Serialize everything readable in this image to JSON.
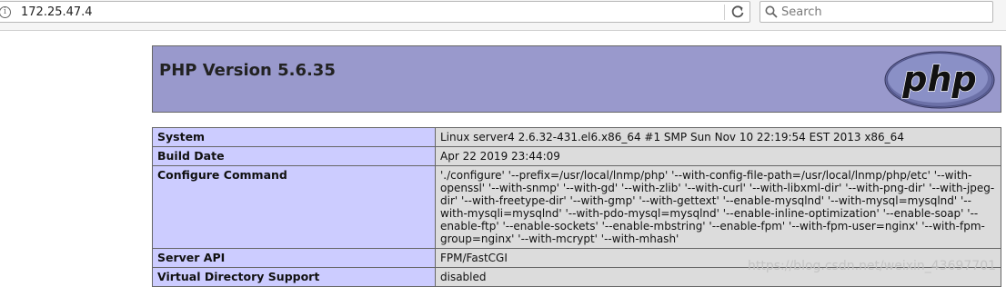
{
  "browser": {
    "url": "172.25.47.4",
    "search_placeholder": "Search"
  },
  "page": {
    "title": "PHP Version 5.6.35",
    "logo_text": "php",
    "rows": [
      {
        "label": "System",
        "value": "Linux server4 2.6.32-431.el6.x86_64 #1 SMP Sun Nov 10 22:19:54 EST 2013 x86_64"
      },
      {
        "label": "Build Date",
        "value": "Apr 22 2019 23:44:09"
      },
      {
        "label": "Configure Command",
        "value": "'./configure' '--prefix=/usr/local/lnmp/php' '--with-config-file-path=/usr/local/lnmp/php/etc' '--with-openssl' '--with-snmp' '--with-gd' '--with-zlib' '--with-curl' '--with-libxml-dir' '--with-png-dir' '--with-jpeg-dir' '--with-freetype-dir' '--with-gmp' '--with-gettext' '--enable-mysqlnd' '--with-mysql=mysqlnd' '--with-mysqli=mysqlnd' '--with-pdo-mysql=mysqlnd' '--enable-inline-optimization' '--enable-soap' '--enable-ftp' '--enable-sockets' '--enable-mbstring' '--enable-fpm' '--with-fpm-user=nginx' '--with-fpm-group=nginx' '--with-mcrypt' '--with-mhash'"
      },
      {
        "label": "Server API",
        "value": "FPM/FastCGI"
      },
      {
        "label": "Virtual Directory Support",
        "value": "disabled"
      }
    ]
  },
  "watermark": "https://blog.csdn.net/weixin_43697701"
}
